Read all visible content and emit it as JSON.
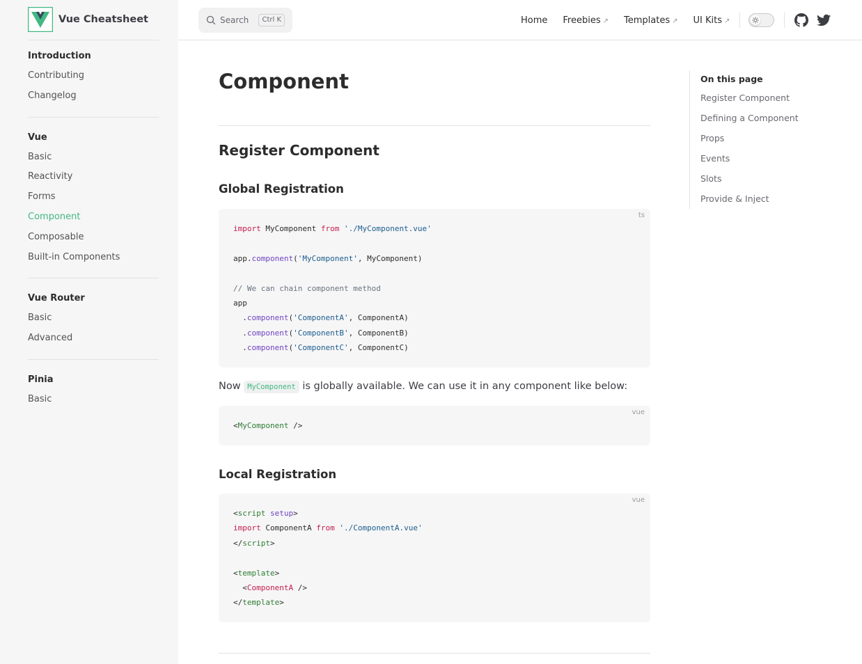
{
  "brand": {
    "title": "Vue Cheatsheet",
    "logo_color": "#42b883",
    "logo_dark": "#35495e"
  },
  "sidebar": {
    "groups": [
      {
        "title": "Introduction",
        "items": [
          "Contributing",
          "Changelog"
        ]
      },
      {
        "title": "Vue",
        "items": [
          "Basic",
          "Reactivity",
          "Forms",
          "Component",
          "Composable",
          "Built-in Components"
        ],
        "active": "Component"
      },
      {
        "title": "Vue Router",
        "items": [
          "Basic",
          "Advanced"
        ]
      },
      {
        "title": "Pinia",
        "items": [
          "Basic"
        ]
      }
    ]
  },
  "header": {
    "search": {
      "label": "Search",
      "shortcut": "Ctrl K"
    },
    "nav": [
      {
        "label": "Home",
        "external": false
      },
      {
        "label": "Freebies",
        "external": true
      },
      {
        "label": "Templates",
        "external": true
      },
      {
        "label": "UI Kits",
        "external": true
      }
    ],
    "external_glyph": "↗",
    "theme_toggle": "sun-icon",
    "social": [
      "github-icon",
      "twitter-icon"
    ]
  },
  "content": {
    "title": "Component",
    "section1": "Register Component",
    "sub1": "Global Registration",
    "code1_lang": "ts",
    "paragraph": {
      "before": "Now",
      "code": "MyComponent",
      "after": "is globally available. We can use it in any component like below:"
    },
    "code2_lang": "vue",
    "sub2": "Local Registration",
    "code3_lang": "vue"
  },
  "outline": {
    "title": "On this page",
    "items": [
      "Register Component",
      "Defining a Component",
      "Props",
      "Events",
      "Slots",
      "Provide & Inject"
    ]
  },
  "colors": {
    "accent": "#42b883",
    "keyword": "#c41d4a",
    "function": "#6f42c1"
  }
}
